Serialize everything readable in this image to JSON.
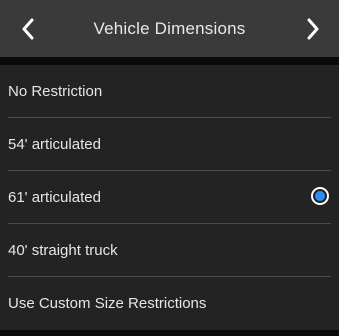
{
  "header": {
    "title": "Vehicle Dimensions",
    "back_icon": "chevron-left-icon",
    "forward_icon": "chevron-right-icon"
  },
  "options": [
    {
      "label": "No Restriction",
      "selected": false
    },
    {
      "label": "54' articulated",
      "selected": false
    },
    {
      "label": "61' articulated",
      "selected": true
    },
    {
      "label": "40' straight truck",
      "selected": false
    },
    {
      "label": "Use Custom Size Restrictions",
      "selected": false
    }
  ],
  "colors": {
    "background": "#232323",
    "header": "#3a3a3a",
    "radio_selected": "#2f8cf3",
    "text": "#e6e6e6"
  }
}
